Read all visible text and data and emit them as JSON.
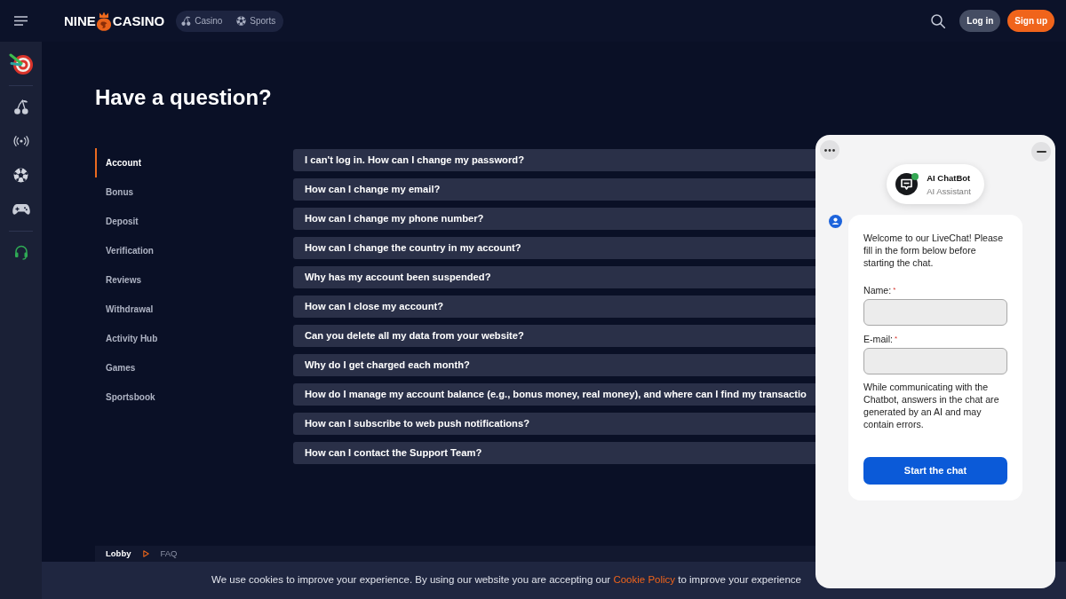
{
  "header": {
    "logo": {
      "word_left": "NINE",
      "word_right": "CASINO"
    },
    "nav_tabs": [
      {
        "label": "Casino"
      },
      {
        "label": "Sports"
      }
    ],
    "buttons": [
      {
        "label": "Log in",
        "kind": "secondary"
      },
      {
        "label": "Sign up",
        "kind": "primary"
      }
    ]
  },
  "page": {
    "title": "Have a question?"
  },
  "categories": [
    {
      "label": "Account",
      "selected": true
    },
    {
      "label": "Bonus",
      "selected": false
    },
    {
      "label": "Deposit",
      "selected": false
    },
    {
      "label": "Verification",
      "selected": false
    },
    {
      "label": "Reviews",
      "selected": false
    },
    {
      "label": "Withdrawal",
      "selected": false
    },
    {
      "label": "Activity Hub",
      "selected": false
    },
    {
      "label": "Games",
      "selected": false
    },
    {
      "label": "Sportsbook",
      "selected": false
    }
  ],
  "questions": [
    {
      "text": "I can't log in. How can I change my password?"
    },
    {
      "text": "How can I change my email?"
    },
    {
      "text": "How can I change my phone number?"
    },
    {
      "text": "How can I change the country in my account?"
    },
    {
      "text": "Why has my account been suspended?"
    },
    {
      "text": "How can I close my account?"
    },
    {
      "text": "Can you delete all my data from your website?"
    },
    {
      "text": "Why do I get charged each month?"
    },
    {
      "text": "How do I manage my account balance (e.g., bonus money, real money), and where can I find my transactio"
    },
    {
      "text": "How can I subscribe to web push notifications?"
    },
    {
      "text": "How can I contact the Support Team?"
    }
  ],
  "breadcrumb": [
    {
      "label": "Lobby",
      "current": false
    },
    {
      "label": "FAQ",
      "current": true
    }
  ],
  "cookie_bar": {
    "text_before": "We use cookies to improve your experience. By using our website you are accepting our",
    "link": "Cookie Policy",
    "text_after": "to improve your experience"
  },
  "chat": {
    "bot": {
      "name": "AI ChatBot",
      "role": "AI Assistant",
      "online": true
    },
    "message": "Welcome to our LiveChat! Please fill in the form below before starting the chat.",
    "fields": [
      {
        "label": "Name:",
        "required_mark": "*"
      },
      {
        "label": "E-mail:",
        "required_mark": "*"
      }
    ],
    "disclaimer": "While communicating with the Chatbot, answers in the chat are generated by an AI and may contain errors.",
    "submit_button": "Start the chat"
  }
}
